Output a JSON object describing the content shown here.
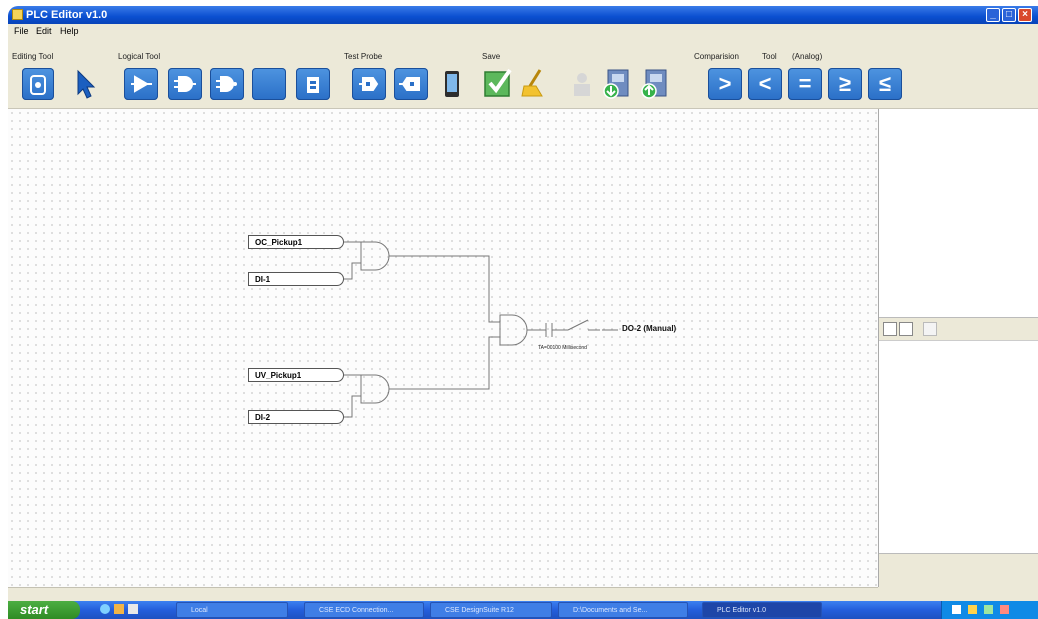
{
  "window": {
    "title": "PLC Editor v1.0"
  },
  "menu": {
    "file": "File",
    "edit": "Edit",
    "help": "Help"
  },
  "toolbar": {
    "groups": {
      "editing": "Editing Tool",
      "logical": "Logical Tool",
      "test_probe": "Test Probe",
      "save": "Save",
      "comparision": "Comparision",
      "tool": "Tool",
      "analog": "(Analog)"
    },
    "compare_symbols": [
      ">",
      "<",
      "=",
      "≥",
      "≤"
    ]
  },
  "diagram": {
    "inputs": [
      "OC_Pickup1",
      "DI-1",
      "UV_Pickup1",
      "DI-2"
    ],
    "output": "DO-2 (Manual)",
    "timer_label": "TA=00100 Millisecond"
  },
  "taskbar": {
    "start": "start",
    "items": [
      "Local",
      "CSE ECD Connection...",
      "CSE DesignSuite R12",
      "D:\\Documents and Se...",
      "PLC Editor v1.0"
    ]
  },
  "colors": {
    "titlebar": "#0a4fd0",
    "tool_blue": "#2a6fc7",
    "taskbar": "#245edb",
    "start": "#2f8c24"
  }
}
